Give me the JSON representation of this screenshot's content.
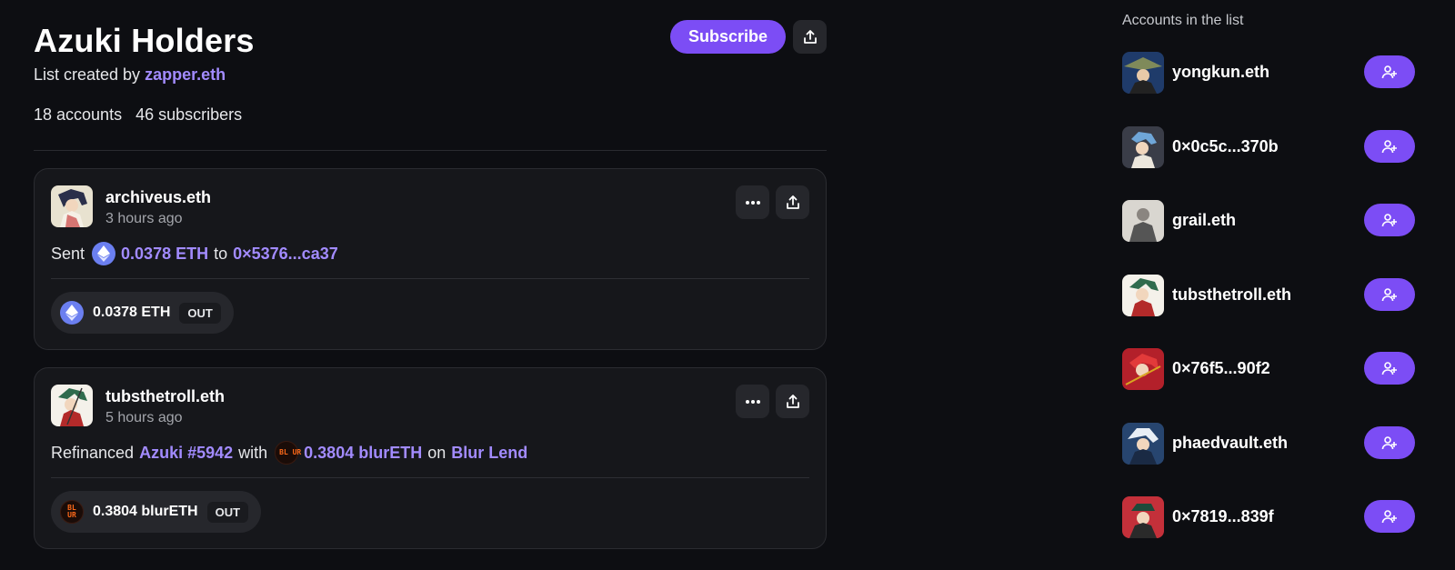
{
  "list": {
    "title": "Azuki Holders",
    "created_prefix": "List created by",
    "creator": "zapper.eth",
    "accounts": "18 accounts",
    "subscribers": "46 subscribers",
    "subscribe_label": "Subscribe"
  },
  "feed": [
    {
      "user": "archiveus.eth",
      "time": "3 hours ago",
      "activity": {
        "verb": "Sent",
        "amount": "0.0378 ETH",
        "mid": "to",
        "target": "0×5376...ca37"
      },
      "pill": {
        "amount": "0.0378 ETH",
        "direction": "OUT",
        "icon": "eth-icon"
      }
    },
    {
      "user": "tubsthetroll.eth",
      "time": "5 hours ago",
      "activity": {
        "verb": "Refinanced",
        "item": "Azuki #5942",
        "with": "with",
        "amount": "0.3804 blurETH",
        "on": "on",
        "protocol": "Blur Lend"
      },
      "pill": {
        "amount": "0.3804 blurETH",
        "direction": "OUT",
        "icon": "blur-icon"
      }
    }
  ],
  "sidebar": {
    "title": "Accounts in the list",
    "accounts": [
      {
        "name": "yongkun.eth"
      },
      {
        "name": "0×0c5c...370b"
      },
      {
        "name": "grail.eth"
      },
      {
        "name": "tubsthetroll.eth"
      },
      {
        "name": "0×76f5...90f2"
      },
      {
        "name": "phaedvault.eth"
      },
      {
        "name": "0×7819...839f"
      }
    ]
  },
  "icons": {
    "blur_glyph": "BL UR"
  },
  "colors": {
    "accent": "#7c4df5",
    "link": "#a28bff",
    "background": "#0d0e12",
    "card": "#16171b"
  }
}
